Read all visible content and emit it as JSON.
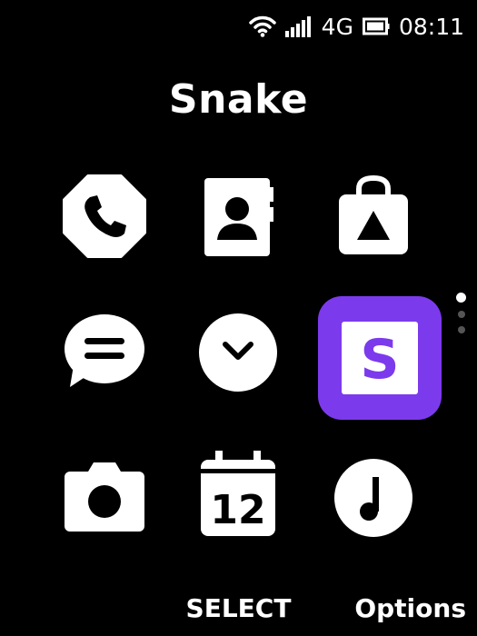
{
  "status": {
    "network": "4G",
    "time": "08:11",
    "icons": [
      "wifi-icon",
      "signal-icon",
      "battery-icon"
    ]
  },
  "header": {
    "title": "Snake"
  },
  "apps": {
    "selected": "snake",
    "items": [
      {
        "id": "phone",
        "icon": "phone-icon"
      },
      {
        "id": "contacts",
        "icon": "contacts-icon"
      },
      {
        "id": "store",
        "icon": "store-bag-icon"
      },
      {
        "id": "messages",
        "icon": "message-bubble-icon"
      },
      {
        "id": "clock",
        "icon": "clock-icon"
      },
      {
        "id": "snake",
        "icon": "snake-s-icon",
        "glyph": "S"
      },
      {
        "id": "camera",
        "icon": "camera-icon"
      },
      {
        "id": "calendar",
        "icon": "calendar-icon",
        "day": "12"
      },
      {
        "id": "music",
        "icon": "music-note-icon"
      }
    ]
  },
  "pager": {
    "pages": 3,
    "current": 1
  },
  "softkeys": {
    "center": "SELECT",
    "right": "Options"
  },
  "colors": {
    "accent": "#7c3aed",
    "background": "#000000",
    "foreground": "#ffffff"
  }
}
